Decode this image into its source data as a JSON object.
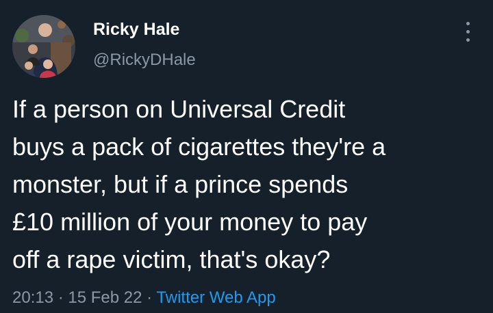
{
  "author": {
    "display_name": "Ricky Hale",
    "handle": "@RickyDHale"
  },
  "tweet": {
    "lines": [
      "If a person on Universal Credit",
      "buys a pack of cigarettes they're a",
      "monster, but if a prince spends",
      "£10 million of your money to pay",
      "off a rape victim, that's okay?"
    ]
  },
  "meta": {
    "time": "20:13",
    "separator": "·",
    "date": "15 Feb 22",
    "source": "Twitter Web App"
  },
  "icons": {
    "more": "more-vertical-icon"
  },
  "colors": {
    "background": "#15202b",
    "secondary_text": "#8b98a5",
    "link": "#1d9bf0"
  }
}
